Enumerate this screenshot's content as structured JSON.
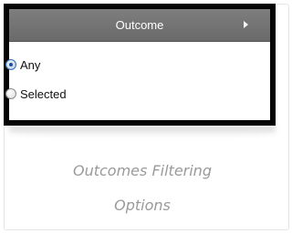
{
  "panel": {
    "title": "Outcome",
    "options": [
      {
        "label": "Any",
        "checked": true
      },
      {
        "label": "Selected",
        "checked": false
      }
    ]
  },
  "caption": {
    "line1": "Outcomes Filtering",
    "line2": "Options"
  }
}
